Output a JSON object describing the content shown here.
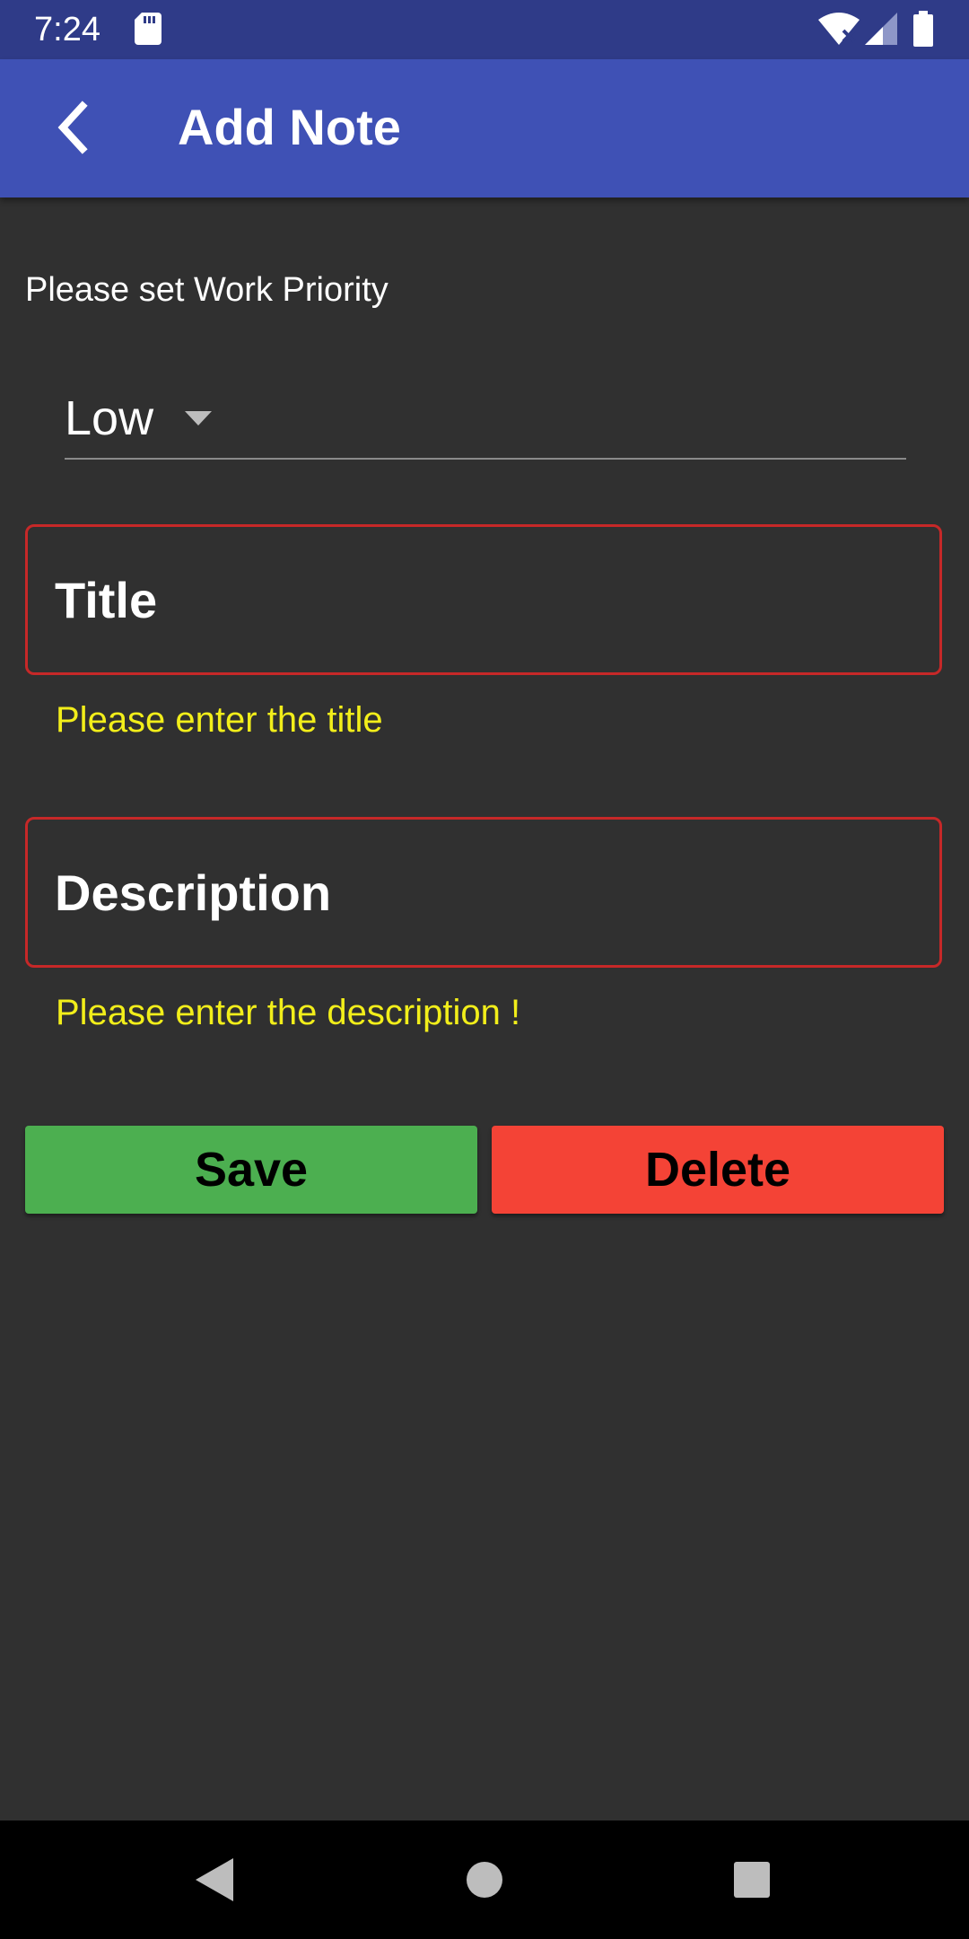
{
  "status_bar": {
    "time": "7:24",
    "icons": [
      "sd-card-icon",
      "wifi-off-icon",
      "cell-signal-icon",
      "battery-icon"
    ]
  },
  "app_bar": {
    "title": "Add Note",
    "back_icon": "chevron-left-icon"
  },
  "form": {
    "priority_label": "Please set Work Priority",
    "priority_value": "Low",
    "title_placeholder": "Title",
    "title_error": "Please enter the title",
    "description_placeholder": "Description",
    "description_error": "Please enter the description !",
    "save_label": "Save",
    "delete_label": "Delete"
  },
  "colors": {
    "status_bar": "#2f3b88",
    "app_bar": "#3f51b5",
    "background": "#303030",
    "error_border": "#c62828",
    "error_text": "#f2ee1a",
    "save_button": "#4caf50",
    "delete_button": "#f44336"
  },
  "nav_bar": {
    "icons": [
      "nav-back-icon",
      "nav-home-icon",
      "nav-recents-icon"
    ]
  }
}
